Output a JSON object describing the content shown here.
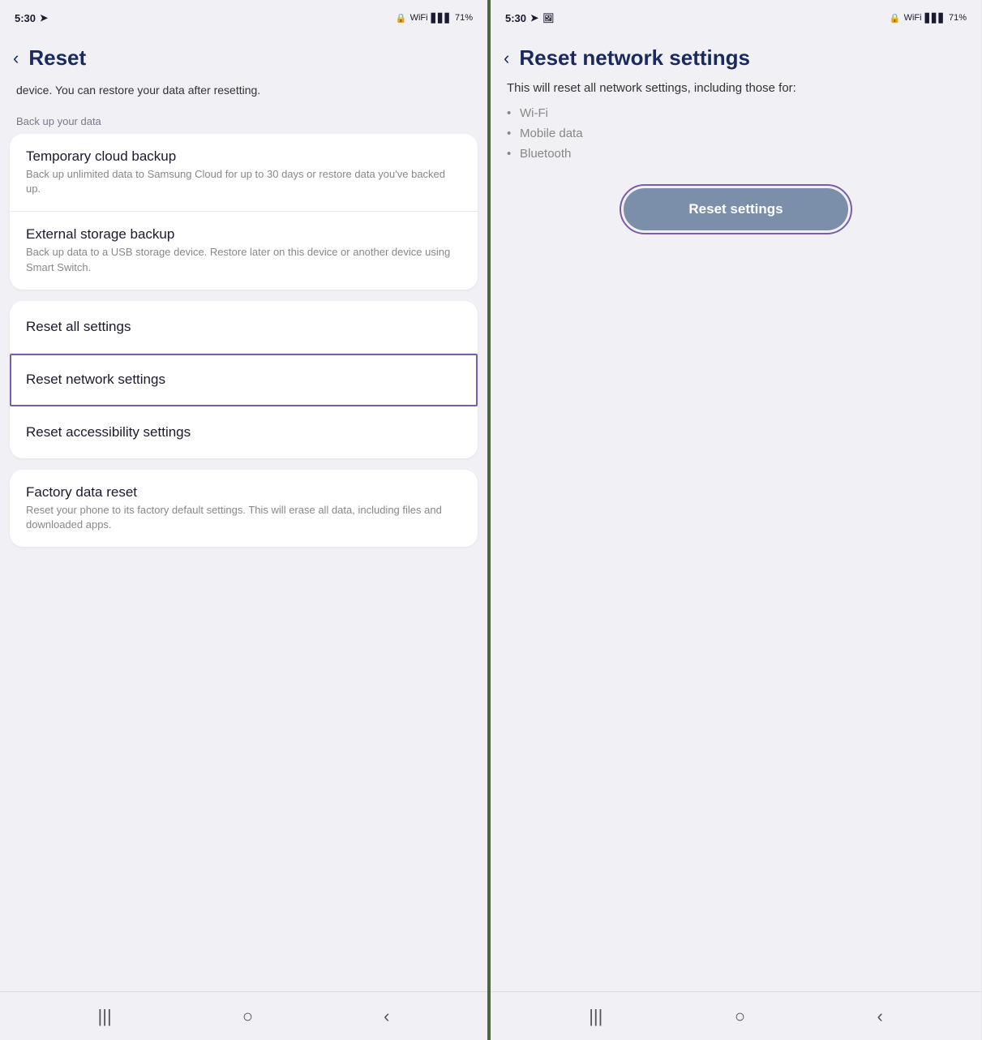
{
  "left_panel": {
    "status": {
      "time": "5:30",
      "battery": "71%"
    },
    "header": {
      "back_label": "‹",
      "title": "Reset"
    },
    "subtitle": "device. You can restore your data after resetting.",
    "section_label": "Back up your data",
    "backup_card": {
      "items": [
        {
          "title": "Temporary cloud backup",
          "desc": "Back up unlimited data to Samsung Cloud for up to 30 days or restore data you've backed up."
        },
        {
          "title": "External storage backup",
          "desc": "Back up data to a USB storage device. Restore later on this device or another device using Smart Switch."
        }
      ]
    },
    "options_card": {
      "items": [
        {
          "title": "Reset all settings",
          "highlighted": false
        },
        {
          "title": "Reset network settings",
          "highlighted": true
        },
        {
          "title": "Reset accessibility settings",
          "highlighted": false
        }
      ]
    },
    "factory_card": {
      "items": [
        {
          "title": "Factory data reset",
          "desc": "Reset your phone to its factory default settings. This will erase all data, including files and downloaded apps."
        }
      ]
    },
    "bottom_nav": {
      "menu_icon": "|||",
      "home_icon": "○",
      "back_icon": "‹"
    }
  },
  "right_panel": {
    "status": {
      "time": "5:30",
      "battery": "71%"
    },
    "header": {
      "back_label": "‹",
      "title": "Reset network settings"
    },
    "description": "This will reset all network settings, including those for:",
    "bullet_items": [
      "Wi-Fi",
      "Mobile data",
      "Bluetooth"
    ],
    "reset_button_label": "Reset settings",
    "bottom_nav": {
      "menu_icon": "|||",
      "home_icon": "○",
      "back_icon": "‹"
    }
  }
}
